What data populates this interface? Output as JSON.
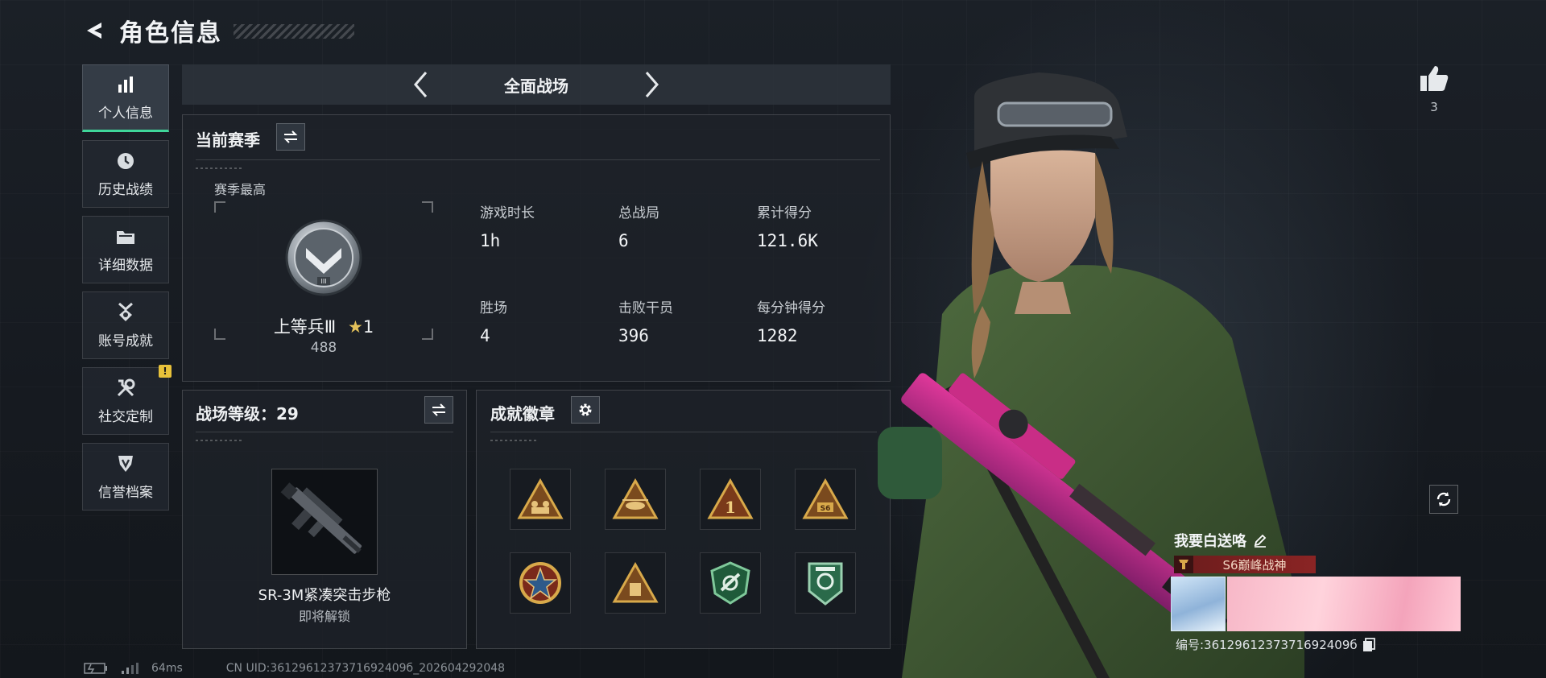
{
  "header": {
    "title": "角色信息"
  },
  "sidebar": {
    "items": [
      {
        "label": "个人信息",
        "icon": "bar-chart-icon",
        "active": true
      },
      {
        "label": "历史战绩",
        "icon": "clock-icon"
      },
      {
        "label": "详细数据",
        "icon": "folder-icon"
      },
      {
        "label": "账号成就",
        "icon": "medal-icon"
      },
      {
        "label": "社交定制",
        "icon": "tools-icon",
        "badge": "!"
      },
      {
        "label": "信誉档案",
        "icon": "shield-icon"
      }
    ]
  },
  "mode": {
    "label": "全面战场"
  },
  "season": {
    "title": "当前赛季",
    "best_label": "赛季最高",
    "rank_name": "上等兵Ⅲ",
    "rank_stars": "1",
    "rank_score": "488",
    "stats": [
      {
        "label": "游戏时长",
        "value": "1h"
      },
      {
        "label": "总战局",
        "value": "6"
      },
      {
        "label": "累计得分",
        "value": "121.6K"
      },
      {
        "label": "胜场",
        "value": "4"
      },
      {
        "label": "击败干员",
        "value": "396"
      },
      {
        "label": "每分钟得分",
        "value": "1282"
      }
    ]
  },
  "level": {
    "title": "战场等级：",
    "value": "29",
    "weapon_name": "SR-3M紧凑突击步枪",
    "weapon_status": "即将解锁"
  },
  "badges": {
    "title": "成就徽章",
    "items": [
      "squad-triangle-badge-icon",
      "helicopter-triangle-badge-icon",
      "number-one-triangle-badge-icon",
      "s6-triangle-badge-icon",
      "star-round-badge-icon",
      "crate-triangle-badge-icon",
      "green-emblem-badge-icon",
      "green-shield-badge-icon"
    ]
  },
  "profile": {
    "like_count": "3",
    "player_name": "我要白送咯",
    "title": "S6巅峰战神",
    "uid": "编号:3612961237371692409б"
  },
  "footer": {
    "ping": "64ms",
    "uid": "CN UID:3612961237371692409б_202604292048"
  },
  "colors": {
    "accent": "#3fd79a",
    "warning": "#e7c13a",
    "gold": "#d8a94a"
  }
}
